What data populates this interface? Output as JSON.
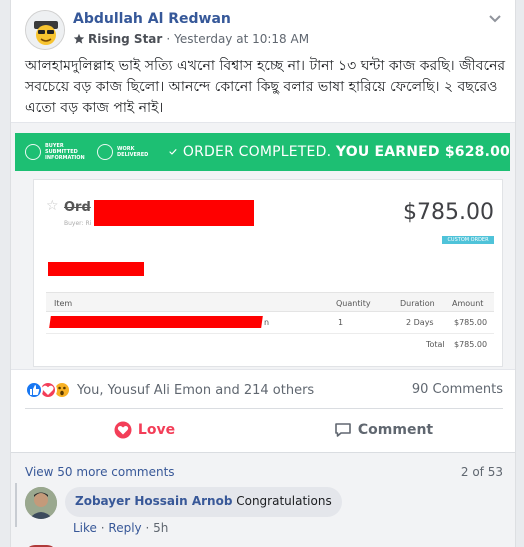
{
  "post": {
    "author": "Abdullah Al Redwan",
    "badge": "Rising Star",
    "separator": "·",
    "timestamp": "Yesterday at 10:18 AM",
    "text": "আলহামদুলিল্লাহ ভাই সত্যি এখনো বিশ্বাস হচ্ছে না। টানা ১৩ ঘন্টা কাজ করছি। জীবনের সবচেয়ে বড় কাজ ছিলো। আনন্দে কোনো কিছু বলার ভাষা হারিয়ে ফেলেছি। ২ বছরেও এতো বড় কাজ পাই নাই।"
  },
  "attachment": {
    "steps": [
      {
        "label": "BUYER SUBMITTED INFORMATION"
      },
      {
        "label": "WORK DELIVERED"
      }
    ],
    "order_status": "ORDER COMPLETED.",
    "earned": "YOU EARNED $628.00",
    "invoice": {
      "order_word": "Ord",
      "buyer_caption": "Buyer: Ri",
      "price": "$785.00",
      "tag": "CUSTOM ORDER",
      "columns": [
        "Item",
        "Quantity",
        "Duration",
        "Amount"
      ],
      "row": {
        "item_suffix": "n",
        "quantity": "1",
        "duration": "2 Days",
        "amount": "$785.00"
      },
      "total_label": "Total",
      "total_value": "$785.00"
    },
    "colors": {
      "green": "#1dbf73",
      "redaction": "#ff0000"
    }
  },
  "reactions": {
    "types": [
      "like",
      "love",
      "wow"
    ],
    "names": "You, Yousuf Ali Emon and 214 others",
    "comments_count": "90 Comments"
  },
  "actions": {
    "love": "Love",
    "comment": "Comment"
  },
  "comments": {
    "view_more": "View 50 more comments",
    "page": "2 of 53",
    "items": [
      {
        "name": "Zobayer Hossain Arnob",
        "text": "Congratulations",
        "like": "Like",
        "reply": "Reply",
        "time": "5h"
      }
    ]
  }
}
